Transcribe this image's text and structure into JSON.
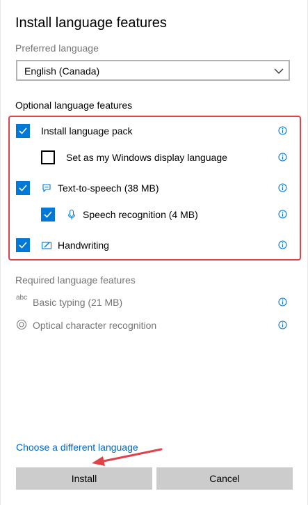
{
  "dialog": {
    "title": "Install language features"
  },
  "preferred": {
    "label": "Preferred language",
    "selected": "English (Canada)"
  },
  "optional": {
    "label": "Optional language features",
    "items": [
      {
        "label": "Install language pack",
        "checked": true,
        "icon": "none"
      },
      {
        "label": "Set as my Windows display language",
        "checked": false,
        "icon": "none"
      },
      {
        "label": "Text-to-speech (38 MB)",
        "checked": true,
        "icon": "speech-bubble-icon"
      },
      {
        "label": "Speech recognition (4 MB)",
        "checked": true,
        "icon": "microphone-icon"
      },
      {
        "label": "Handwriting",
        "checked": true,
        "icon": "pen-icon"
      }
    ]
  },
  "required": {
    "label": "Required language features",
    "items": [
      {
        "label": "Basic typing (21 MB)",
        "icon": "abc-icon",
        "icon_text": "abc"
      },
      {
        "label": "Optical character recognition",
        "icon": "ocr-icon"
      }
    ]
  },
  "footer": {
    "link": "Choose a different language",
    "install_label": "Install",
    "cancel_label": "Cancel"
  },
  "colors": {
    "accent": "#0078d7",
    "link": "#0067c0",
    "highlight": "#e0424a",
    "info": "#0078d7",
    "button": "#cccccc"
  }
}
